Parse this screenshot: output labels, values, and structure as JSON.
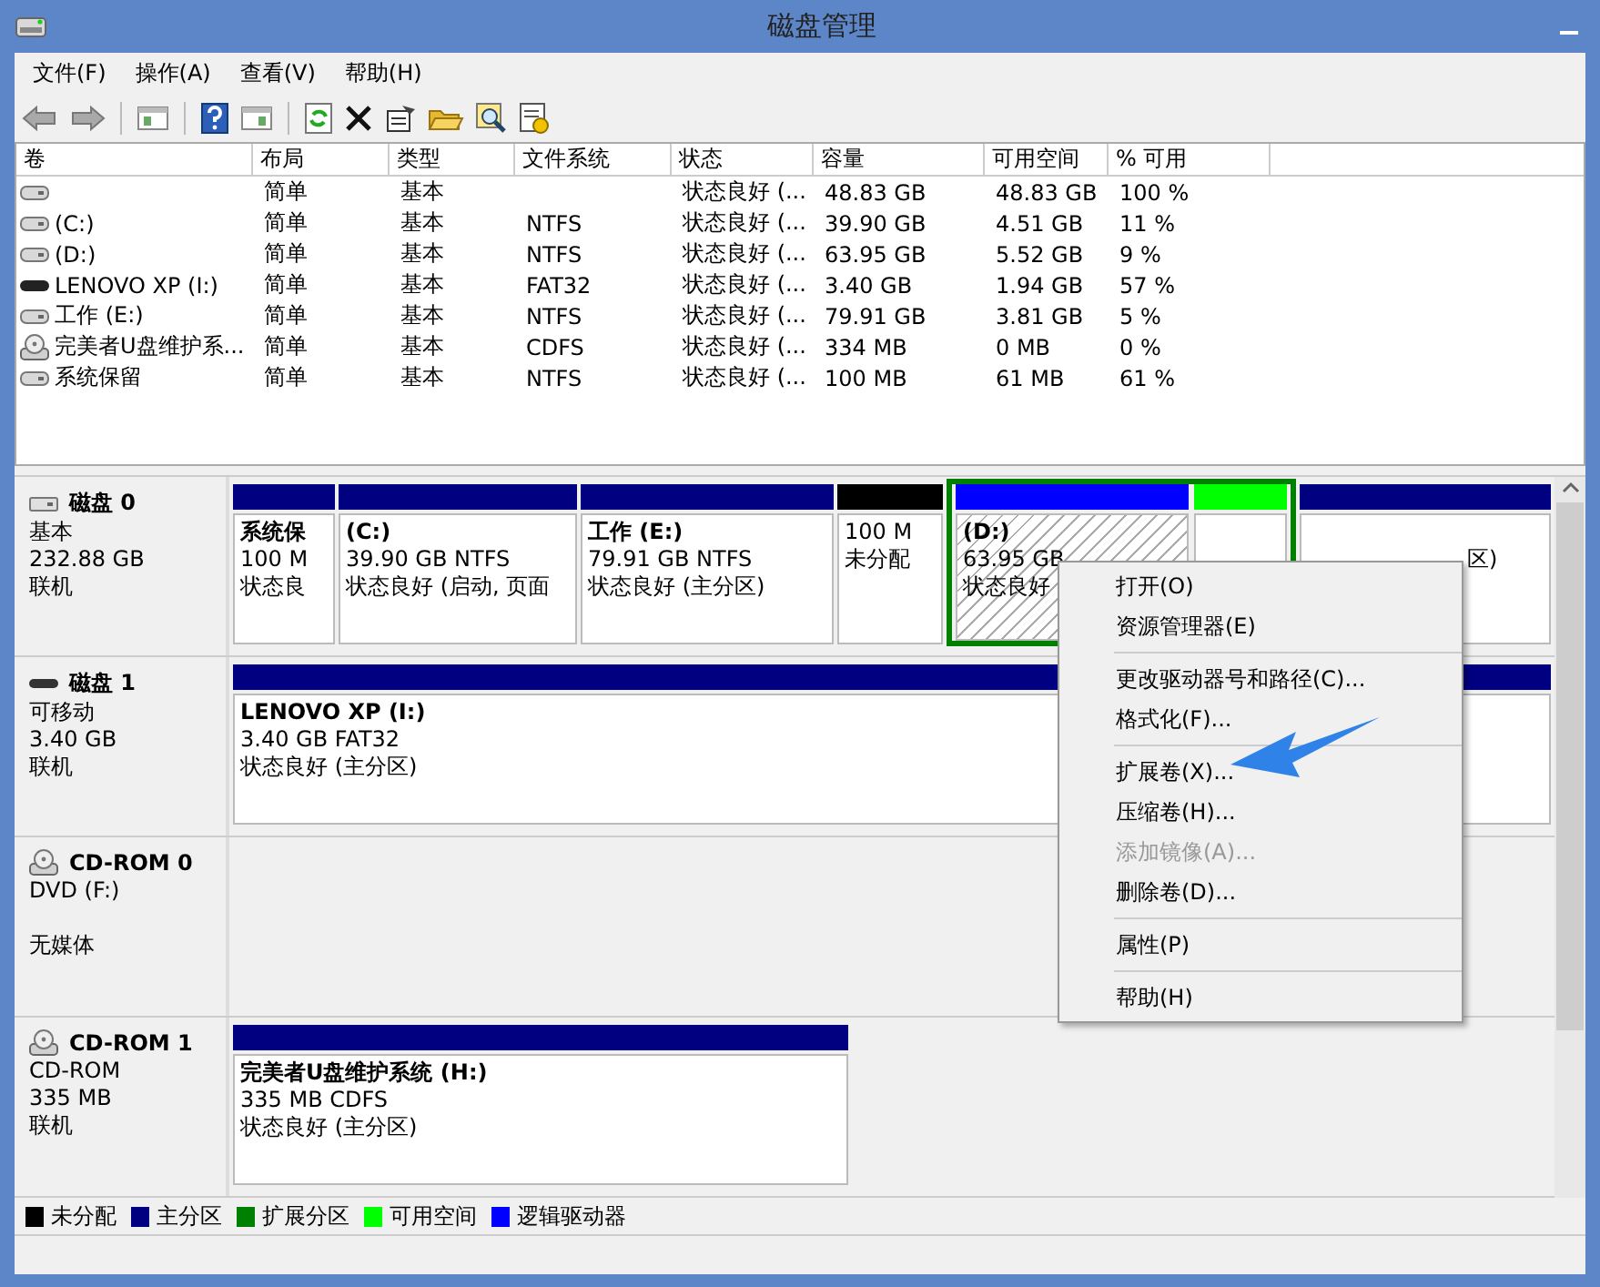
{
  "window": {
    "title": "磁盘管理"
  },
  "menu": [
    {
      "label": "文件(F)"
    },
    {
      "label": "操作(A)"
    },
    {
      "label": "查看(V)"
    },
    {
      "label": "帮助(H)"
    }
  ],
  "volumes": {
    "columns": [
      "卷",
      "布局",
      "类型",
      "文件系统",
      "状态",
      "容量",
      "可用空间",
      "% 可用"
    ],
    "rows": [
      {
        "kind": "disk",
        "cells": [
          "",
          "简单",
          "基本",
          "",
          "状态良好 (...",
          "48.83 GB",
          "48.83 GB",
          "100 %"
        ]
      },
      {
        "kind": "disk",
        "cells": [
          "(C:)",
          "简单",
          "基本",
          "NTFS",
          "状态良好 (...",
          "39.90 GB",
          "4.51 GB",
          "11 %"
        ]
      },
      {
        "kind": "disk",
        "cells": [
          "(D:)",
          "简单",
          "基本",
          "NTFS",
          "状态良好 (...",
          "63.95 GB",
          "5.52 GB",
          "9 %"
        ]
      },
      {
        "kind": "removable",
        "cells": [
          "LENOVO XP (I:)",
          "简单",
          "基本",
          "FAT32",
          "状态良好 (...",
          "3.40 GB",
          "1.94 GB",
          "57 %"
        ]
      },
      {
        "kind": "disk",
        "cells": [
          "工作 (E:)",
          "简单",
          "基本",
          "NTFS",
          "状态良好 (...",
          "79.91 GB",
          "3.81 GB",
          "5 %"
        ]
      },
      {
        "kind": "cd",
        "cells": [
          "完美者U盘维护系...",
          "简单",
          "基本",
          "CDFS",
          "状态良好 (...",
          "334 MB",
          "0 MB",
          "0 %"
        ]
      },
      {
        "kind": "disk",
        "cells": [
          "系统保留",
          "简单",
          "基本",
          "NTFS",
          "状态良好 (...",
          "100 MB",
          "61 MB",
          "61 %"
        ]
      }
    ]
  },
  "disks": [
    {
      "kind": "disk",
      "name": "磁盘 0",
      "type": "基本",
      "size": "232.88 GB",
      "status": "联机",
      "partitions": [
        {
          "kind": "volume",
          "color": "#000080",
          "title": "系统保",
          "size": "100 M",
          "status": "状态良",
          "selected": false
        },
        {
          "kind": "volume",
          "color": "#000080",
          "title": "(C:)",
          "size": "39.90 GB NTFS",
          "status": "状态良好 (启动, 页面",
          "selected": false
        },
        {
          "kind": "volume",
          "color": "#000080",
          "title": "工作 (E:)",
          "size": "79.91 GB NTFS",
          "status": "状态良好 (主分区)",
          "selected": false
        },
        {
          "kind": "volume",
          "color": "#000000",
          "size": "100 M",
          "status": "未分配",
          "selected": false
        },
        {
          "kind": "extended",
          "color": "#008000",
          "children": [
            {
              "color": "#0000ff",
              "title": "(D:)",
              "size": "63.95 GB",
              "status": "状态良好",
              "selected": true
            },
            {
              "color": "#00ff00",
              "selected": false
            }
          ]
        },
        {
          "kind": "volume",
          "color": "#000080",
          "status": "区)",
          "selected": false
        }
      ]
    },
    {
      "kind": "removable",
      "name": "磁盘 1",
      "type": "可移动",
      "size": "3.40 GB",
      "status": "联机",
      "partitions": [
        {
          "kind": "volume",
          "color": "#000080",
          "title": "LENOVO XP (I:)",
          "size": "3.40 GB FAT32",
          "status": "状态良好 (主分区)",
          "selected": false
        }
      ]
    },
    {
      "kind": "cd",
      "name": "CD-ROM 0",
      "type": "DVD (F:)",
      "status": "无媒体"
    },
    {
      "kind": "cd",
      "name": "CD-ROM 1",
      "type": "CD-ROM",
      "size": "335 MB",
      "status": "联机",
      "partitions": [
        {
          "kind": "volume",
          "color": "#000080",
          "title": "完美者U盘维护系统 (H:)",
          "size": "335 MB CDFS",
          "status": "状态良好 (主分区)",
          "selected": false
        }
      ]
    }
  ],
  "legend": [
    {
      "label": "未分配",
      "color": "#000000"
    },
    {
      "label": "主分区",
      "color": "#000080"
    },
    {
      "label": "扩展分区",
      "color": "#008000"
    },
    {
      "label": "可用空间",
      "color": "#00ff00"
    },
    {
      "label": "逻辑驱动器",
      "color": "#0000ff"
    }
  ],
  "context_menu": [
    {
      "kind": "item",
      "label": "打开(O)",
      "disabled": false
    },
    {
      "kind": "item",
      "label": "资源管理器(E)",
      "disabled": false
    },
    {
      "kind": "separator"
    },
    {
      "kind": "item",
      "label": "更改驱动器号和路径(C)...",
      "disabled": false
    },
    {
      "kind": "item",
      "label": "格式化(F)...",
      "disabled": false
    },
    {
      "kind": "separator"
    },
    {
      "kind": "item",
      "label": "扩展卷(X)...",
      "disabled": false
    },
    {
      "kind": "item",
      "label": "压缩卷(H)...",
      "disabled": false
    },
    {
      "kind": "item",
      "label": "添加镜像(A)...",
      "disabled": true
    },
    {
      "kind": "item",
      "label": "删除卷(D)...",
      "disabled": false
    },
    {
      "kind": "separator"
    },
    {
      "kind": "item",
      "label": "属性(P)",
      "disabled": false
    },
    {
      "kind": "separator"
    },
    {
      "kind": "item",
      "label": "帮助(H)",
      "disabled": false
    }
  ]
}
